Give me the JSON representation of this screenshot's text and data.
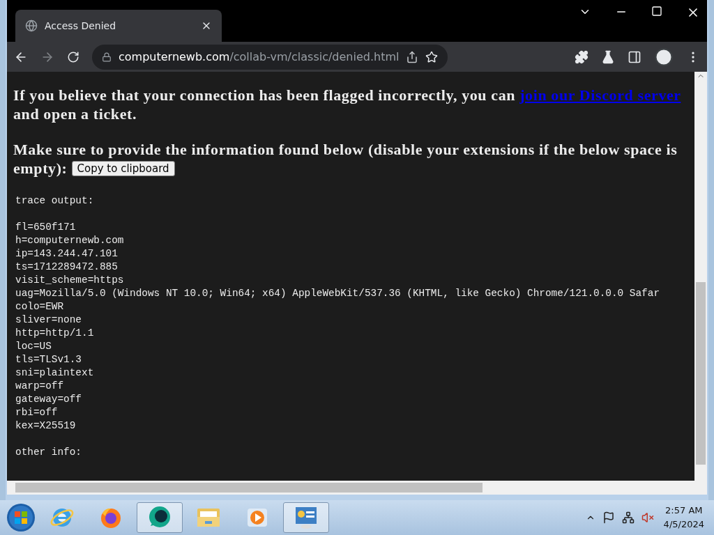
{
  "browser": {
    "tabs": [
      {
        "title": "Access Denied",
        "selected": true
      }
    ],
    "address": {
      "domain": "computernewb.com",
      "path": "/collab-vm/classic/denied.html"
    }
  },
  "page": {
    "notice": {
      "before": "If you believe that your connection has been flagged incorrectly, you can ",
      "link": "join our Discord server",
      "after": " and open a ticket."
    },
    "instruction": {
      "lines": [
        "Make sure to provide the information found below (disable your extensions if the below space is",
        "empty):"
      ],
      "button": "Copy to clipboard"
    },
    "trace": {
      "heading": "trace output:",
      "lines": [
        "fl=650f171",
        "h=computernewb.com",
        "ip=143.244.47.101",
        "ts=1712289472.885",
        "visit_scheme=https",
        "uag=Mozilla/5.0 (Windows NT 10.0; Win64; x64) AppleWebKit/537.36 (KHTML, like Gecko) Chrome/121.0.0.0 Safar",
        "colo=EWR",
        "sliver=none",
        "http=http/1.1",
        "loc=US",
        "tls=TLSv1.3",
        "sni=plaintext",
        "warp=off",
        "gateway=off",
        "rbi=off",
        "kex=X25519"
      ],
      "footer": "other info:"
    }
  },
  "taskbar": {
    "apps": [
      {
        "kind": "ie",
        "selected": false
      },
      {
        "kind": "firefox",
        "selected": false
      },
      {
        "kind": "chat",
        "selected": true
      },
      {
        "kind": "folder",
        "selected": false
      },
      {
        "kind": "media",
        "selected": false
      },
      {
        "kind": "panel",
        "selected": true
      }
    ],
    "clock": {
      "time": "2:57 AM",
      "date": "4/5/2024"
    }
  }
}
